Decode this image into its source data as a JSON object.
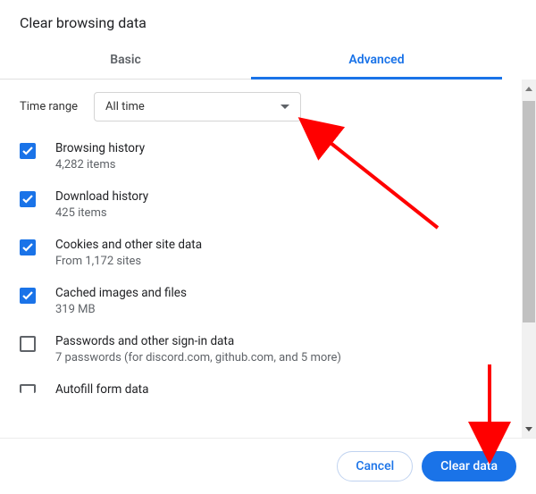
{
  "dialog": {
    "title": "Clear browsing data"
  },
  "tabs": {
    "basic": "Basic",
    "advanced": "Advanced"
  },
  "time_range": {
    "label": "Time range",
    "selected": "All time"
  },
  "items": [
    {
      "title": "Browsing history",
      "sub": "4,282 items",
      "checked": true
    },
    {
      "title": "Download history",
      "sub": "425 items",
      "checked": true
    },
    {
      "title": "Cookies and other site data",
      "sub": "From 1,172 sites",
      "checked": true
    },
    {
      "title": "Cached images and files",
      "sub": "319 MB",
      "checked": true
    },
    {
      "title": "Passwords and other sign-in data",
      "sub": "7 passwords (for discord.com, github.com, and 5 more)",
      "checked": false
    },
    {
      "title": "Autofill form data",
      "sub": "",
      "checked": false
    }
  ],
  "footer": {
    "cancel": "Cancel",
    "clear": "Clear data"
  }
}
